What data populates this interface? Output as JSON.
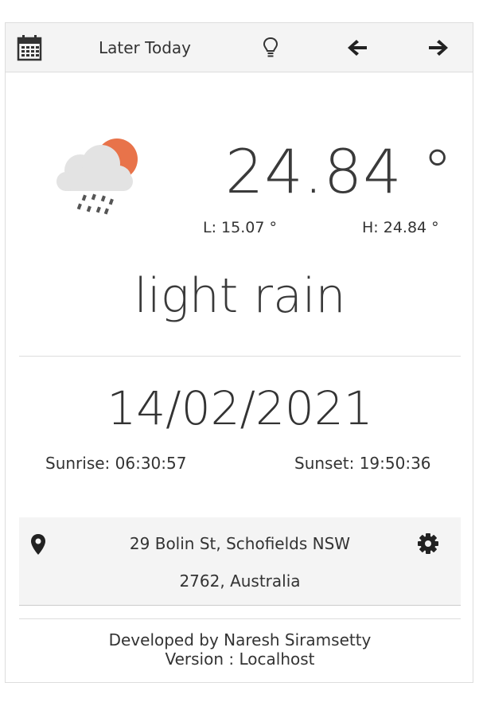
{
  "toolbar": {
    "calendar_icon": "calendar-icon",
    "title": "Later Today",
    "tip_icon": "lightbulb-icon",
    "prev_icon": "arrow-left-icon",
    "next_icon": "arrow-right-icon"
  },
  "weather": {
    "icon": "rain-cloud-sun-icon",
    "temperature": "24.84 °",
    "low": "L:  15.07 °",
    "high": "H:  24.84 °",
    "description": "light rain"
  },
  "day": {
    "date": "14/02/2021",
    "sunrise": "Sunrise:  06:30:57",
    "sunset": "Sunset:  19:50:36"
  },
  "location": {
    "pin_icon": "map-pin-icon",
    "line1": "29 Bolin St, Schofields NSW",
    "line2": "2762, Australia",
    "settings_icon": "gear-icon"
  },
  "footer": {
    "credit": "Developed by Naresh Siramsetty",
    "version": "Version : Localhost"
  },
  "colors": {
    "sun": "#e8734a",
    "cloud": "#e3e3e3",
    "rain": "#555555",
    "panel": "#f4f4f4"
  }
}
